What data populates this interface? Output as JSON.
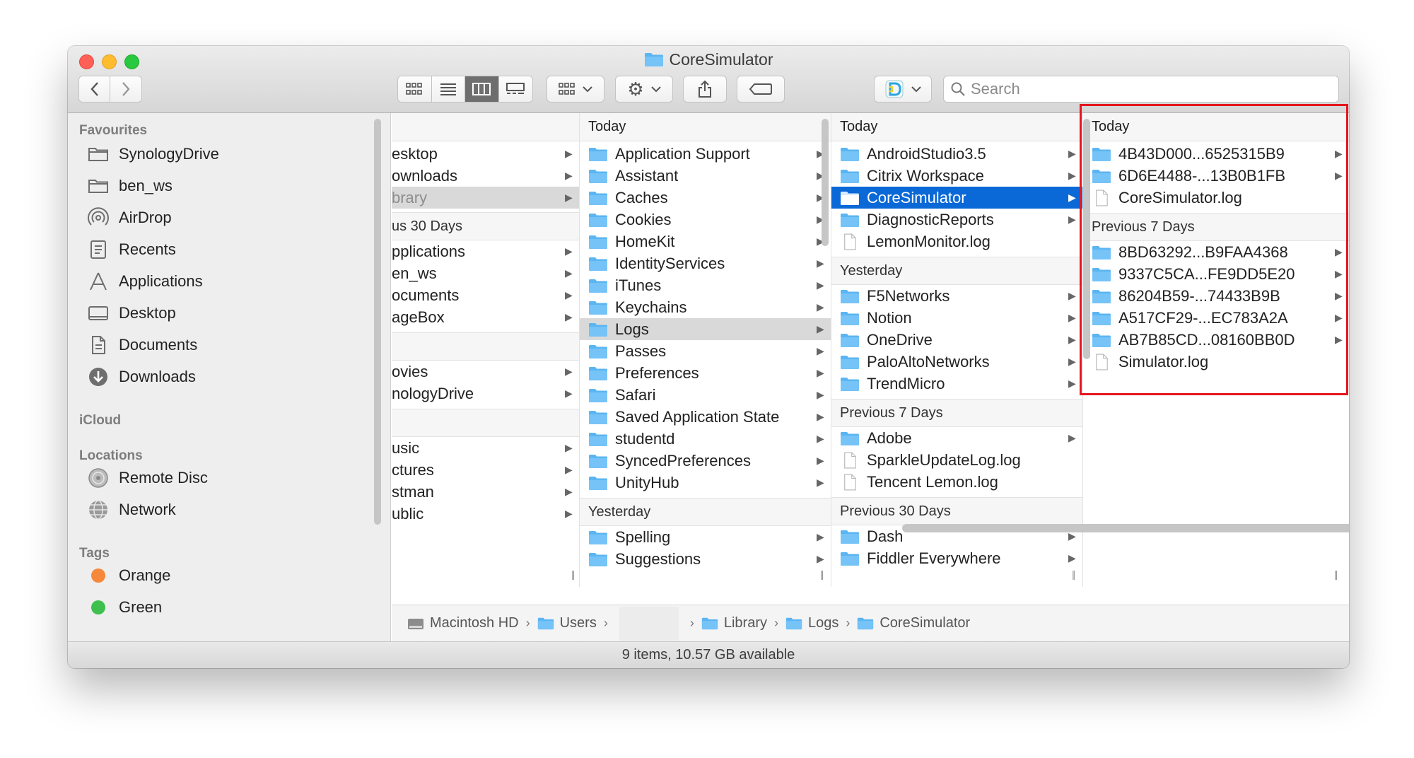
{
  "window": {
    "title": "CoreSimulator"
  },
  "toolbar": {
    "search_placeholder": "Search"
  },
  "sidebar": {
    "favourites_title": "Favourites",
    "favourites": [
      {
        "label": "SynologyDrive",
        "icon": "folder-icon"
      },
      {
        "label": "ben_ws",
        "icon": "folder-icon"
      },
      {
        "label": "AirDrop",
        "icon": "airdrop-icon"
      },
      {
        "label": "Recents",
        "icon": "recents-icon"
      },
      {
        "label": "Applications",
        "icon": "applications-icon"
      },
      {
        "label": "Desktop",
        "icon": "desktop-icon"
      },
      {
        "label": "Documents",
        "icon": "documents-icon"
      },
      {
        "label": "Downloads",
        "icon": "downloads-icon"
      }
    ],
    "icloud_title": "iCloud",
    "locations_title": "Locations",
    "locations": [
      {
        "label": "Remote Disc",
        "icon": "disc-icon"
      },
      {
        "label": "Network",
        "icon": "network-icon"
      }
    ],
    "tags_title": "Tags",
    "tags": [
      {
        "label": "Orange",
        "color": "#f5883a"
      },
      {
        "label": "Green",
        "color": "#3fc04e"
      }
    ]
  },
  "columns": {
    "col1": {
      "rows_a": [
        "esktop",
        "ownloads",
        "brary"
      ],
      "group_b": "us 30 Days",
      "rows_b": [
        "pplications",
        "en_ws",
        "ocuments",
        "ageBox"
      ],
      "rows_c": [
        "ovies",
        "nologyDrive"
      ],
      "rows_d": [
        "usic",
        "ctures",
        "stman",
        "ublic"
      ]
    },
    "col2": {
      "header": "Today",
      "items": [
        "Application Support",
        "Assistant",
        "Caches",
        "Cookies",
        "HomeKit",
        "IdentityServices",
        "iTunes",
        "Keychains",
        "Logs",
        "Passes",
        "Preferences",
        "Safari",
        "Saved Application State",
        "studentd",
        "SyncedPreferences",
        "UnityHub"
      ],
      "group2": "Yesterday",
      "items2": [
        "Spelling",
        "Suggestions"
      ]
    },
    "col3": {
      "header": "Today",
      "items": [
        "AndroidStudio3.5",
        "Citrix Workspace",
        "CoreSimulator",
        "DiagnosticReports",
        "LemonMonitor.log"
      ],
      "group2": "Yesterday",
      "items2": [
        "F5Networks",
        "Notion",
        "OneDrive",
        "PaloAltoNetworks",
        "TrendMicro"
      ],
      "group3": "Previous 7 Days",
      "items3": [
        "Adobe",
        "SparkleUpdateLog.log",
        "Tencent Lemon.log"
      ],
      "group4": "Previous 30 Days",
      "items4": [
        "Dash",
        "Fiddler Everywhere"
      ]
    },
    "col4": {
      "header": "Today",
      "items": [
        "4B43D000...6525315B9",
        "6D6E4488-...13B0B1FB",
        "CoreSimulator.log"
      ],
      "group2": "Previous 7 Days",
      "items2": [
        "8BD63292...B9FAA4368",
        "9337C5CA...FE9DD5E20",
        "86204B59-...74433B9B",
        "A517CF29-...EC783A2A",
        "AB7B85CD...08160BB0D",
        "Simulator.log"
      ]
    }
  },
  "pathbar": [
    "Macintosh HD",
    "Users",
    "Library",
    "Logs",
    "CoreSimulator"
  ],
  "status": "9 items, 10.57 GB available"
}
